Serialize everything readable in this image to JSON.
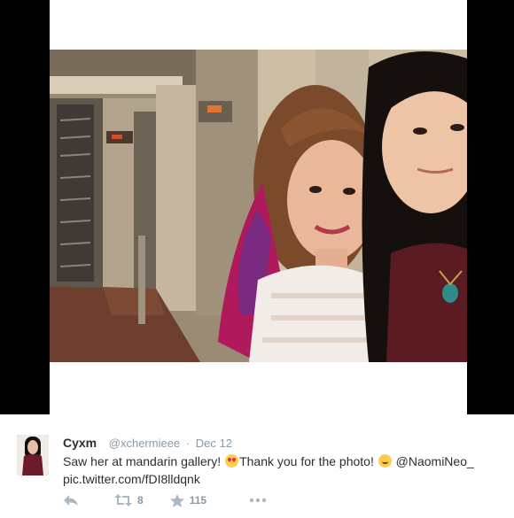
{
  "colors": {
    "frame": "#000000",
    "text": "#292f33",
    "muted": "#8899a6",
    "action_icon": "#aab8c2"
  },
  "media": {
    "icon": "photo"
  },
  "tweet": {
    "author_name": "Cyxm",
    "author_handle": "@xchermieee",
    "separator": "·",
    "date": "Dec 12",
    "text_part1": "Saw her at mandarin gallery! ",
    "emoji1": "smiling-face-with-heart-eyes",
    "text_part2": "Thank you for the photo! ",
    "emoji2": "smiling-face-with-smiling-eyes",
    "mention": "@NaomiNeo_",
    "link": "pic.twitter.com/fDI8lldqnk"
  },
  "actions": {
    "reply_icon": "reply-icon",
    "retweet_icon": "retweet-icon",
    "retweet_count": "8",
    "favorite_icon": "star-icon",
    "favorite_count": "115",
    "more_icon": "more-icon"
  }
}
